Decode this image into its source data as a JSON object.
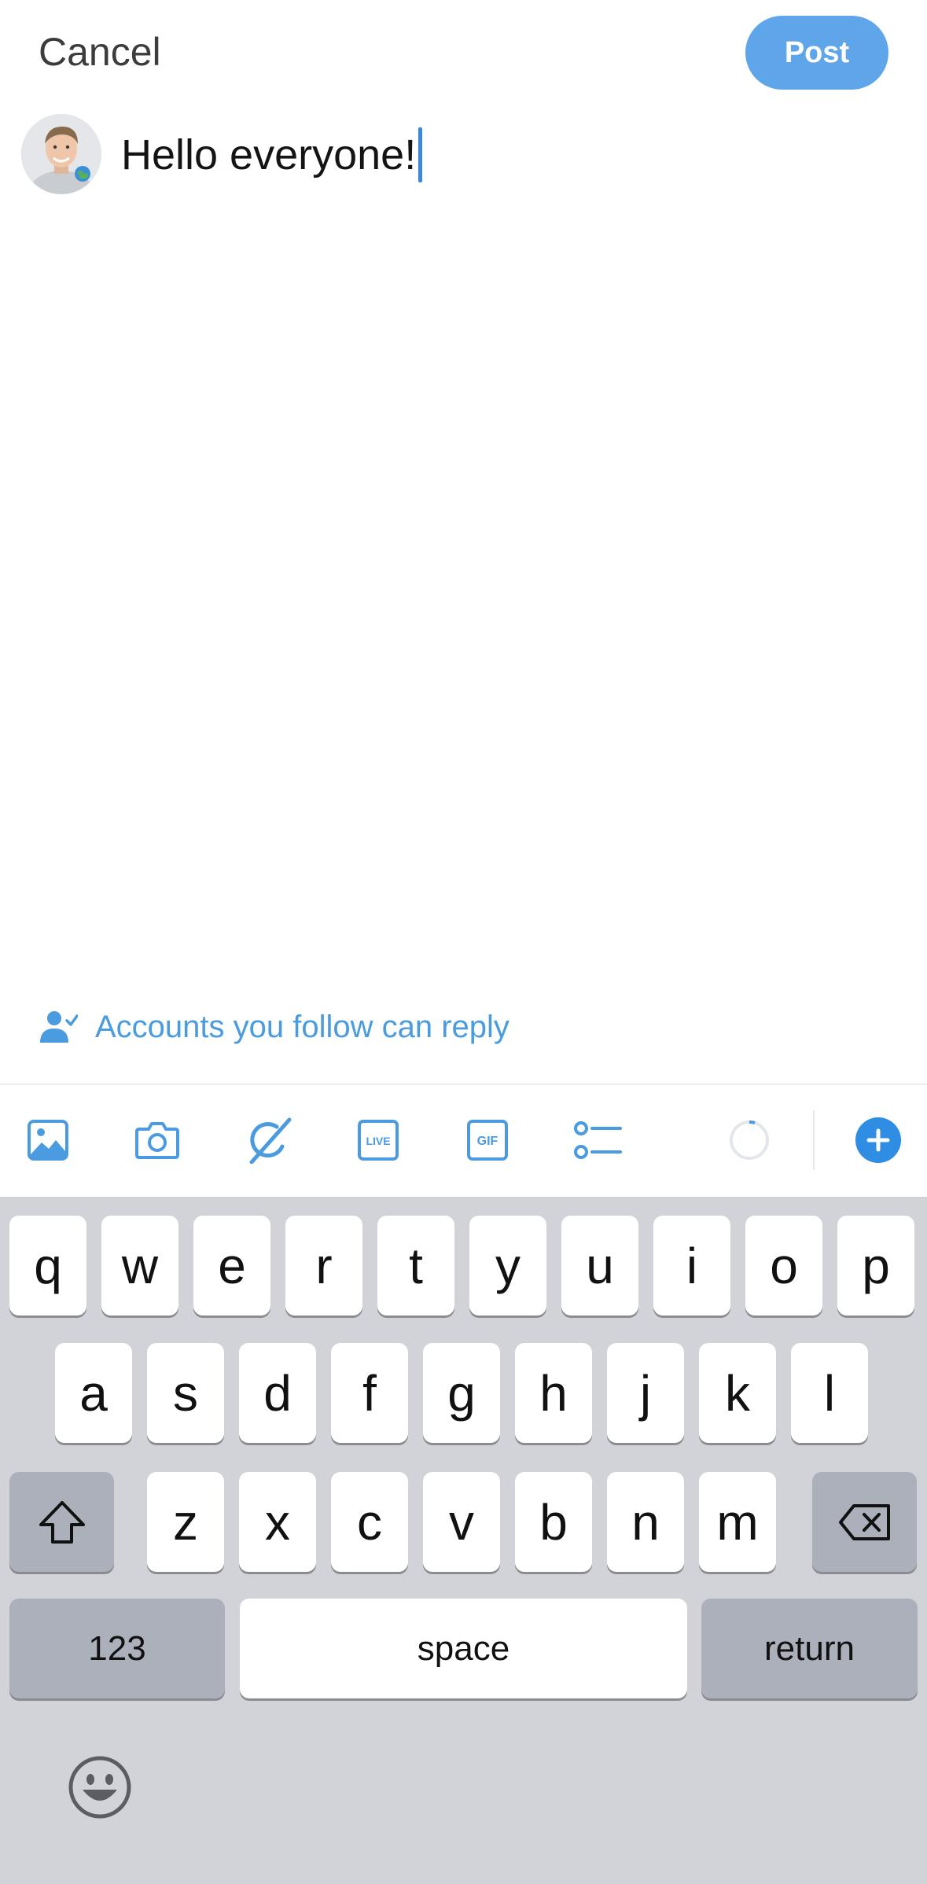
{
  "header": {
    "cancel_label": "Cancel",
    "post_label": "Post"
  },
  "composer": {
    "text": "Hello everyone!",
    "avatar_icon": "user-avatar-photo"
  },
  "reply_settings": {
    "label": "Accounts you follow can reply",
    "icon": "person-check-icon"
  },
  "toolbar": {
    "items": [
      "image-icon",
      "camera-icon",
      "grok-icon",
      "live-icon",
      "gif-icon",
      "poll-icon"
    ],
    "live_text": "LIVE",
    "gif_text": "GIF",
    "progress_icon": "character-count-ring-icon",
    "add_icon": "add-thread-icon"
  },
  "keyboard": {
    "row1": [
      "q",
      "w",
      "e",
      "r",
      "t",
      "y",
      "u",
      "i",
      "o",
      "p"
    ],
    "row2": [
      "a",
      "s",
      "d",
      "f",
      "g",
      "h",
      "j",
      "k",
      "l"
    ],
    "row3": [
      "z",
      "x",
      "c",
      "v",
      "b",
      "n",
      "m"
    ],
    "numbers_label": "123",
    "space_label": "space",
    "return_label": "return",
    "shift_icon": "shift-icon",
    "delete_icon": "backspace-icon",
    "emoji_icon": "emoji-icon"
  },
  "colors": {
    "accent": "#1d9bf0",
    "post_button": "#5fa5ea",
    "reply_text": "#4a9be0",
    "keyboard_bg": "#d1d3d9"
  }
}
